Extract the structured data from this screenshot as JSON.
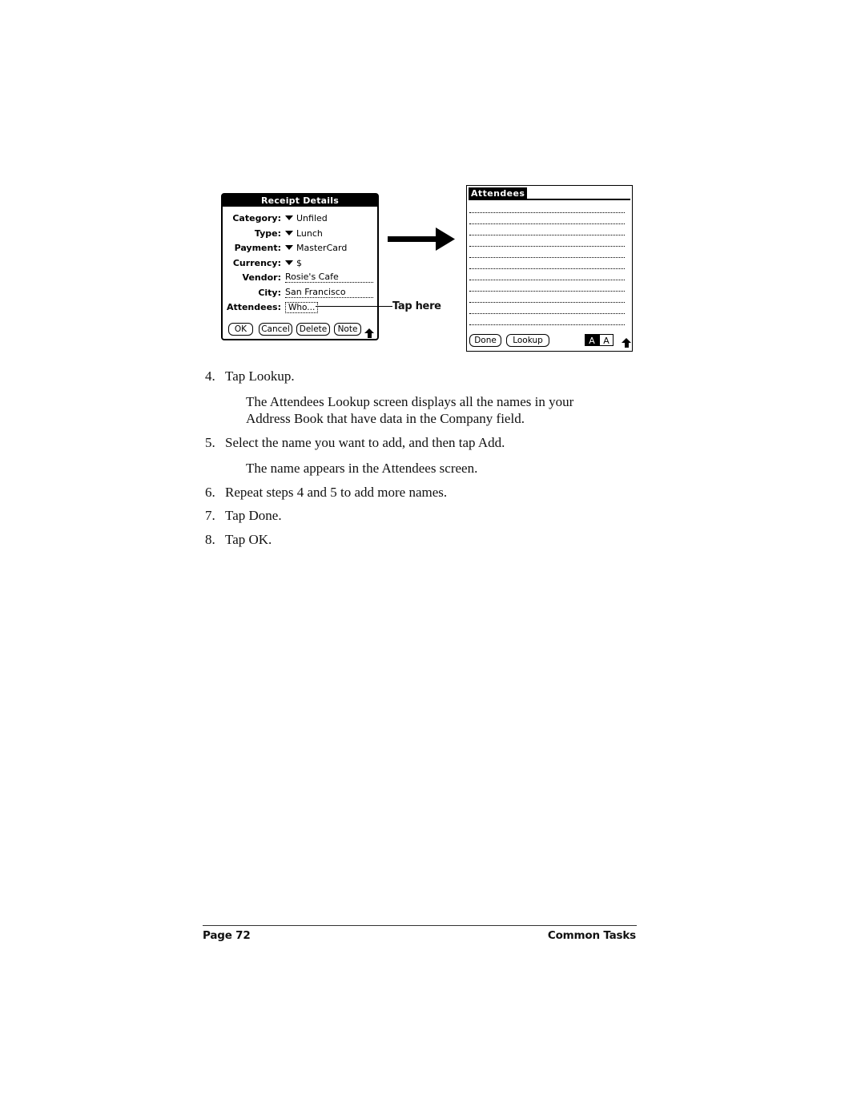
{
  "receipt_screen": {
    "title": "Receipt Details",
    "fields": [
      {
        "label": "Category:",
        "value": "Unfiled",
        "kind": "picker"
      },
      {
        "label": "Type:",
        "value": "Lunch",
        "kind": "picker"
      },
      {
        "label": "Payment:",
        "value": "MasterCard",
        "kind": "picker"
      },
      {
        "label": "Currency:",
        "value": "$",
        "kind": "picker"
      },
      {
        "label": "Vendor:",
        "value": "Rosie's Cafe",
        "kind": "text"
      },
      {
        "label": "City:",
        "value": "San Francisco",
        "kind": "text"
      },
      {
        "label": "Attendees:",
        "value": "Who...",
        "kind": "button"
      }
    ],
    "buttons": {
      "ok": "OK",
      "cancel": "Cancel",
      "delete": "Delete",
      "note": "Note"
    }
  },
  "callout": {
    "text": "Tap here"
  },
  "attendees_screen": {
    "title": "Attendees",
    "buttons": {
      "done": "Done",
      "lookup": "Lookup"
    },
    "case_indicator": {
      "upper": "A",
      "lower": "A"
    }
  },
  "steps": [
    {
      "num": "4.",
      "text": "Tap Lookup."
    },
    {
      "num": "5.",
      "text": "Select the name you want to add, and then tap Add."
    },
    {
      "num": "6.",
      "text": "Repeat steps 4 and 5 to add more names."
    },
    {
      "num": "7.",
      "text": "Tap Done."
    },
    {
      "num": "8.",
      "text": "Tap OK."
    }
  ],
  "notes": {
    "step4_line1": "The Attendees Lookup screen displays all the names in your",
    "step4_line2": "Address Book that have data in the Company field.",
    "step5": "The name appears in the Attendees screen."
  },
  "footer": {
    "page": "Page 72",
    "section": "Common Tasks"
  }
}
